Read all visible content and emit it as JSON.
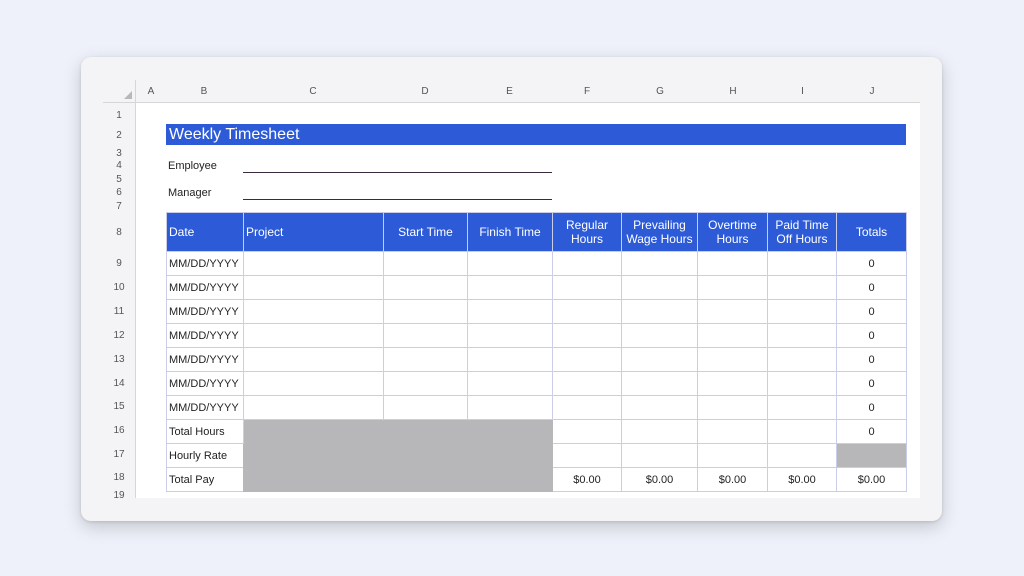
{
  "columns": [
    "A",
    "B",
    "C",
    "D",
    "E",
    "F",
    "G",
    "H",
    "I",
    "J"
  ],
  "rows": [
    "1",
    "2",
    "3",
    "4",
    "5",
    "6",
    "7",
    "8",
    "9",
    "10",
    "11",
    "12",
    "13",
    "14",
    "15",
    "16",
    "17",
    "18",
    "19"
  ],
  "title": "Weekly Timesheet",
  "form": {
    "employee_label": "Employee",
    "manager_label": "Manager"
  },
  "table": {
    "headers": [
      "Date",
      "Project",
      "Start Time",
      "Finish Time",
      "Regular Hours",
      "Prevailing Wage Hours",
      "Overtime Hours",
      "Paid Time Off Hours",
      "Totals"
    ],
    "day_rows": [
      {
        "date": "MM/DD/YYYY",
        "total": "0"
      },
      {
        "date": "MM/DD/YYYY",
        "total": "0"
      },
      {
        "date": "MM/DD/YYYY",
        "total": "0"
      },
      {
        "date": "MM/DD/YYYY",
        "total": "0"
      },
      {
        "date": "MM/DD/YYYY",
        "total": "0"
      },
      {
        "date": "MM/DD/YYYY",
        "total": "0"
      },
      {
        "date": "MM/DD/YYYY",
        "total": "0"
      }
    ],
    "total_hours_label": "Total Hours",
    "total_hours_value": "0",
    "hourly_rate_label": "Hourly Rate",
    "total_pay_label": "Total Pay",
    "total_pay_values": [
      "$0.00",
      "$0.00",
      "$0.00",
      "$0.00",
      "$0.00"
    ]
  },
  "colors": {
    "header_blue": "#2d5bd7",
    "gray_block": "#b7b7b9",
    "background": "#eef1fa"
  }
}
